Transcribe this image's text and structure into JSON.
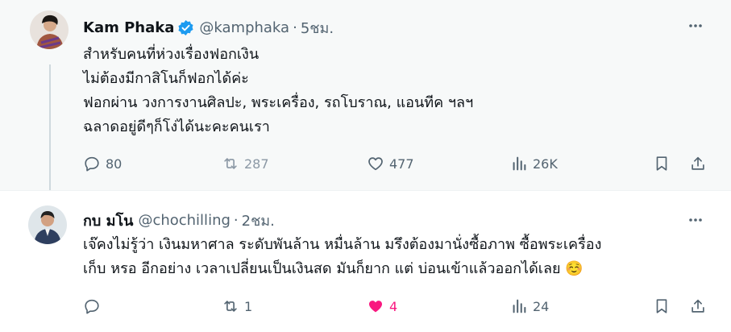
{
  "colors": {
    "verified": "#1d9bf0",
    "like_active": "#f91880",
    "secondary_text": "#536471",
    "highlight_bg": "#f7f9f9"
  },
  "tweets": [
    {
      "author": {
        "name": "Kam Phaka",
        "handle": "@kamphaka",
        "verified": true,
        "avatar_icon": "avatar-photo"
      },
      "separator": "·",
      "time": "5ชม.",
      "text_lines": [
        "สำหรับคนที่ห่วงเรื่องฟอกเงิน",
        "ไม่ต้องมีกาสิโนก็ฟอกได้ค่ะ",
        "ฟอกผ่าน วงการงานศิลปะ, พระเครื่อง, รถโบราณ, แอนทีค ฯลฯ",
        "ฉลาดอยู่ดีๆก็โง่ได้นะคะคนเรา"
      ],
      "stats": {
        "replies": "80",
        "reposts": "287",
        "likes": "477",
        "views": "26K"
      },
      "liked": false
    },
    {
      "author": {
        "name": "กบ มโน",
        "handle": "@chochilling",
        "verified": false,
        "avatar_icon": "avatar-photo"
      },
      "separator": "·",
      "time": "2ชม.",
      "text_lines": [
        "เจ๊คงไม่รู้ว่า เงินมหาศาล ระดับพันล้าน หมื่นล้าน มรึงต้องมานั่งซื้อภาพ ซื้อพระเครื่อง",
        "เก็บ หรอ อีกอย่าง เวลาเปลี่ยนเป็นเงินสด มันก็ยาก แต่ บ่อนเข้าแล้วออกได้เลย ☺️"
      ],
      "stats": {
        "replies": "",
        "reposts": "1",
        "likes": "4",
        "views": "24"
      },
      "liked": true
    }
  ]
}
